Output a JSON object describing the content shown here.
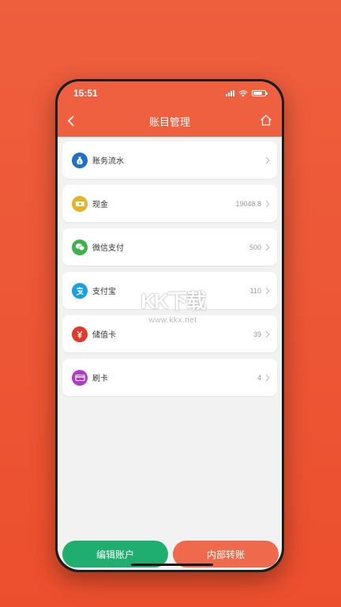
{
  "status_bar": {
    "time": "15:51"
  },
  "navbar": {
    "title": "账目管理"
  },
  "rows": [
    {
      "label": "账务流水",
      "value": "",
      "icon": "money-bag-icon",
      "color": "#1f6fc2"
    },
    {
      "label": "现金",
      "value": "19048.8",
      "icon": "cash-icon",
      "color": "#e6b22a"
    },
    {
      "label": "微信支付",
      "value": "500",
      "icon": "wechat-icon",
      "color": "#3bb34a"
    },
    {
      "label": "支付宝",
      "value": "110",
      "icon": "alipay-icon",
      "color": "#1a9fe0"
    },
    {
      "label": "储值卡",
      "value": "39",
      "icon": "yen-card-icon",
      "color": "#e03a2a"
    },
    {
      "label": "刷卡",
      "value": "4",
      "icon": "card-swipe-icon",
      "color": "#b33ac8"
    }
  ],
  "watermark": {
    "big": "KK下载",
    "small": "www.kkx.net"
  },
  "buttons": {
    "edit": "编辑账户",
    "transfer": "内部转账"
  },
  "colors": {
    "header": "#ef6040",
    "edit_button": "#1fae6f",
    "transfer_button": "#ef6a4c",
    "background": "#ec5634"
  }
}
